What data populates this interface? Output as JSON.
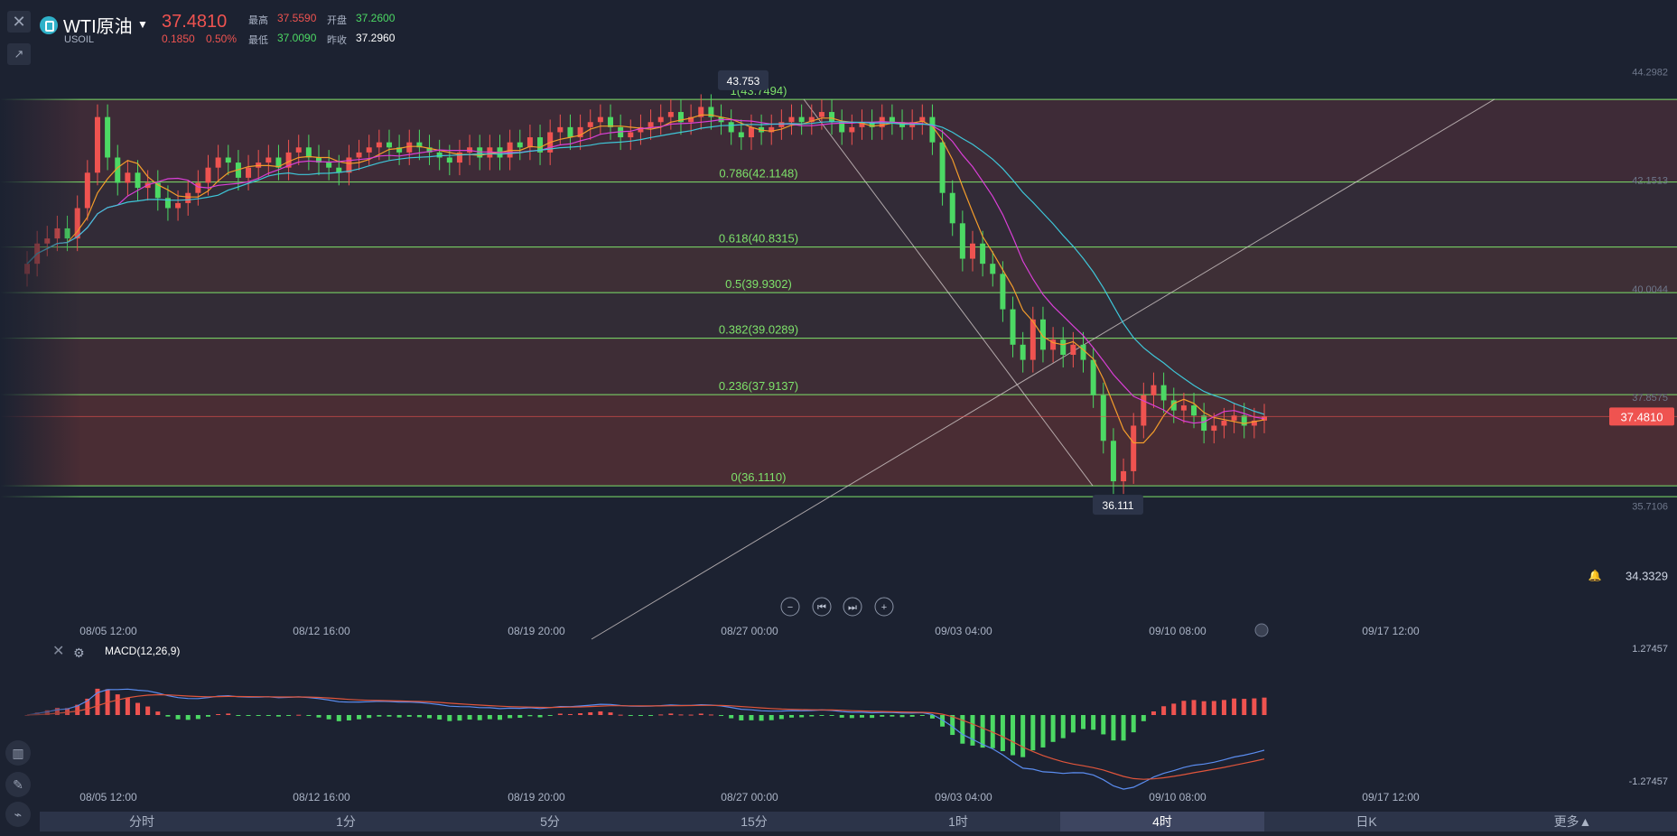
{
  "header": {
    "name": "WTI原油",
    "code": "USOIL",
    "price": "37.4810",
    "change": "0.1850",
    "change_pct": "0.50%",
    "high_label": "最高",
    "high": "37.5590",
    "open_label": "开盘",
    "open": "37.2600",
    "low_label": "最低",
    "low": "37.0090",
    "prev_label": "昨收",
    "prev": "37.2960"
  },
  "colors": {
    "up": "#ef5350",
    "down": "#4cd964",
    "fib": "#7ee26a",
    "ma5": "#f39c2b",
    "ma10": "#d93fd6",
    "ma20": "#3ec6d8",
    "macd_line": "#5b8df0",
    "signal_line": "#e0553b"
  },
  "toolbar": {
    "close_icon": "close-icon",
    "draw_icon": "draw-tool-icon"
  },
  "chart_data": [
    {
      "type": "candlestick",
      "symbol": "USOIL",
      "interval": "4时",
      "price_axis_labels": [
        "44.2982",
        "42.1513",
        "40.0044",
        "37.8575",
        "35.7106"
      ],
      "ylim": [
        33.4,
        45.0
      ],
      "last_price": "37.4810",
      "alert_value": "34.3329",
      "time_labels": [
        "08/05 12:00",
        "08/12 16:00",
        "08/19 20:00",
        "08/27 00:00",
        "09/03 04:00",
        "09/10 08:00",
        "09/17 12:00"
      ],
      "fib_levels": [
        {
          "ratio": 1,
          "price": 43.7494,
          "label": "1(43.7494)"
        },
        {
          "ratio": 0.786,
          "price": 42.1148,
          "label": "0.786(42.1148)"
        },
        {
          "ratio": 0.618,
          "price": 40.8315,
          "label": "0.618(40.8315)"
        },
        {
          "ratio": 0.5,
          "price": 39.9302,
          "label": "0.5(39.9302)"
        },
        {
          "ratio": 0.382,
          "price": 39.0289,
          "label": "0.382(39.0289)"
        },
        {
          "ratio": 0.236,
          "price": 37.9137,
          "label": "0.236(37.9137)"
        },
        {
          "ratio": 0,
          "price": 36.111,
          "label": "0(36.1110)"
        }
      ],
      "high_marker": {
        "label": "43.753",
        "price": 43.753
      },
      "low_marker": {
        "label": "36.111",
        "price": 36.111
      },
      "close_series": [
        40.5,
        40.9,
        41.0,
        41.2,
        41.0,
        41.6,
        42.3,
        43.4,
        42.6,
        42.1,
        42.3,
        42.0,
        42.1,
        41.8,
        41.6,
        41.7,
        41.9,
        42.1,
        42.4,
        42.6,
        42.5,
        42.2,
        42.4,
        42.5,
        42.6,
        42.4,
        42.7,
        42.8,
        42.6,
        42.5,
        42.4,
        42.3,
        42.6,
        42.7,
        42.8,
        42.9,
        42.8,
        42.7,
        42.9,
        42.8,
        42.7,
        42.6,
        42.5,
        42.7,
        42.8,
        42.6,
        42.8,
        42.6,
        42.9,
        42.8,
        43.0,
        42.7,
        43.1,
        43.2,
        43.0,
        43.2,
        43.3,
        43.4,
        43.2,
        43.0,
        43.1,
        43.2,
        43.3,
        43.4,
        43.5,
        43.3,
        43.4,
        43.6,
        43.4,
        43.3,
        43.1,
        43.0,
        43.2,
        43.1,
        43.2,
        43.3,
        43.4,
        43.3,
        43.4,
        43.5,
        43.3,
        43.1,
        43.2,
        43.3,
        43.2,
        43.4,
        43.3,
        43.2,
        43.3,
        43.4,
        42.9,
        41.9,
        41.3,
        40.6,
        40.9,
        40.5,
        40.3,
        39.6,
        38.9,
        38.6,
        39.4,
        38.8,
        39.0,
        38.7,
        38.9,
        38.6,
        37.9,
        37.0,
        36.2,
        36.4,
        37.3,
        37.9,
        38.1,
        37.8,
        37.6,
        37.7,
        37.5,
        37.2,
        37.3,
        37.4,
        37.5,
        37.3,
        37.4,
        37.48
      ]
    },
    {
      "type": "bar",
      "title": "MACD(12,26,9)",
      "axis_labels": [
        "1.27457",
        "-1.27457"
      ],
      "ylim": [
        -1.27457,
        1.27457
      ],
      "time_labels": [
        "08/05 12:00",
        "08/12 16:00",
        "08/19 20:00",
        "08/27 00:00",
        "09/03 04:00",
        "09/10 08:00",
        "09/17 12:00"
      ]
    }
  ],
  "period_tabs": [
    "分时",
    "1分",
    "5分",
    "15分",
    "1时",
    "4时",
    "日K",
    "更多▲"
  ],
  "active_tab": "4时"
}
